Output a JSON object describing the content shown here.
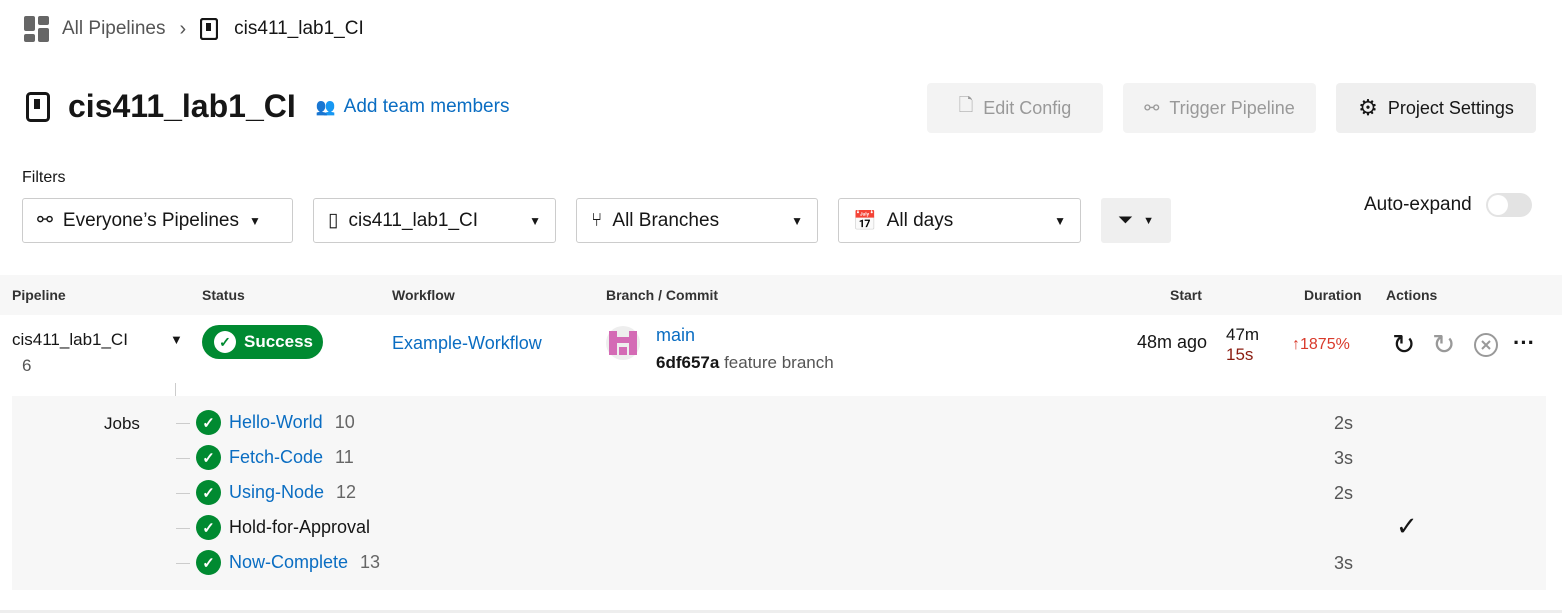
{
  "breadcrumb": {
    "root": "All Pipelines",
    "project": "cis411_lab1_CI"
  },
  "header": {
    "title": "cis411_lab1_CI",
    "add_team": "Add team members",
    "edit_config": "Edit Config",
    "trigger": "Trigger Pipeline",
    "settings": "Project Settings"
  },
  "filters": {
    "label": "Filters",
    "pipelines": "Everyone’s Pipelines",
    "project": "cis411_lab1_CI",
    "branches": "All Branches",
    "days": "All days",
    "auto_expand": "Auto-expand",
    "auto_expand_on": false
  },
  "table": {
    "headers": [
      "Pipeline",
      "Status",
      "Workflow",
      "Branch / Commit",
      "Start",
      "Duration",
      "Actions"
    ]
  },
  "row": {
    "pipeline": "cis411_lab1_CI",
    "number": "6",
    "status": "Success",
    "workflow": "Example-Workflow",
    "branch": "main",
    "commit": "6df657a",
    "commit_msg": "feature branch",
    "start": "48m ago",
    "duration1": "47m",
    "duration2": "15s",
    "change": "1875%"
  },
  "jobs": {
    "label": "Jobs",
    "items": [
      {
        "name": "Hello-World",
        "num": "10",
        "dur": "2s"
      },
      {
        "name": "Fetch-Code",
        "num": "11",
        "dur": "3s"
      },
      {
        "name": "Using-Node",
        "num": "12",
        "dur": "2s"
      },
      {
        "name": "Hold-for-Approval",
        "num": "",
        "dur": ""
      },
      {
        "name": "Now-Complete",
        "num": "13",
        "dur": "3s"
      }
    ]
  },
  "colors": {
    "success": "#008a31",
    "link": "#0a6dc2",
    "increase": "#d93a2b"
  }
}
